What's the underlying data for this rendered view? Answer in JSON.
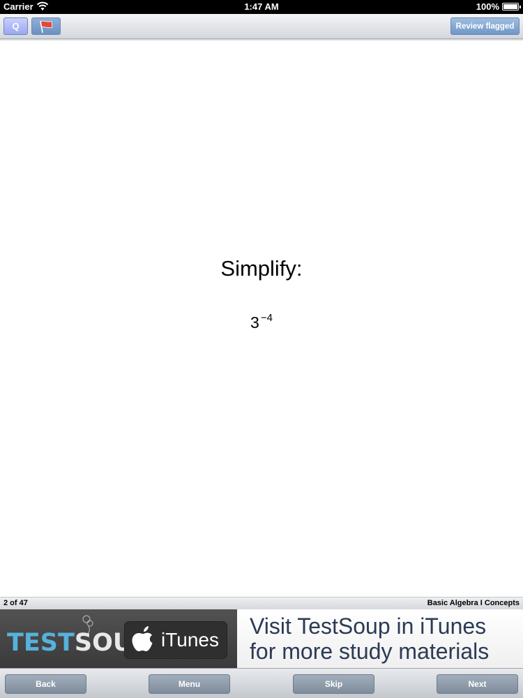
{
  "status_bar": {
    "carrier": "Carrier",
    "time": "1:47 AM",
    "battery": "100%"
  },
  "toolbar": {
    "q_label": "Q",
    "flag_icon": "flag-icon",
    "review_label": "Review flagged"
  },
  "question": {
    "prompt": "Simplify:",
    "base": "3",
    "exponent": "−4"
  },
  "info_bar": {
    "progress": "2 of 47",
    "deck": "Basic Algebra I Concepts"
  },
  "ad": {
    "logo_part1": "TEST",
    "logo_part2": "SOUP",
    "badge_label": "iTunes",
    "line1": "Visit TestSoup in iTunes",
    "line2": "for more study materials"
  },
  "bottom_toolbar": {
    "back_label": "Back",
    "menu_label": "Menu",
    "skip_label": "Skip",
    "next_label": "Next"
  },
  "colors": {
    "status_bar_bg": "#000000",
    "accent_blue": "#6f97c9",
    "logo_blue": "#56b2dc",
    "ad_text": "#2b3a55"
  }
}
